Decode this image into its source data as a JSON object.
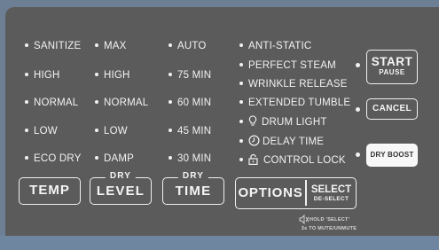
{
  "temp": {
    "options": [
      "SANITIZE",
      "HIGH",
      "NORMAL",
      "LOW",
      "ECO DRY"
    ],
    "button": "TEMP"
  },
  "dry_level": {
    "options": [
      "MAX",
      "HIGH",
      "NORMAL",
      "LOW",
      "DAMP"
    ],
    "tag": "DRY",
    "button": "LEVEL"
  },
  "dry_time": {
    "options": [
      "AUTO",
      "75 MIN",
      "60 MIN",
      "45 MIN",
      "30 MIN"
    ],
    "tag": "DRY",
    "button": "TIME"
  },
  "options_list": [
    "ANTI-STATIC",
    "PERFECT STEAM",
    "WRINKLE RELEASE",
    "EXTENDED TUMBLE",
    "DRUM LIGHT",
    "DELAY TIME",
    "CONTROL LOCK"
  ],
  "options_button": "OPTIONS",
  "select_button": {
    "main": "SELECT",
    "sub": "DE-SELECT"
  },
  "mute_hint": {
    "line1": "HOLD 'SELECT'",
    "line2": "3s TO MUTE/UNMUTE"
  },
  "start_button": {
    "main": "START",
    "sub": "PAUSE"
  },
  "cancel_button": "CANCEL",
  "dry_boost_button": "DRY BOOST",
  "icons": {
    "drum_light": "lightbulb-icon",
    "delay_time": "clock-icon",
    "control_lock": "lock-icon",
    "mute": "speaker-mute-icon"
  }
}
